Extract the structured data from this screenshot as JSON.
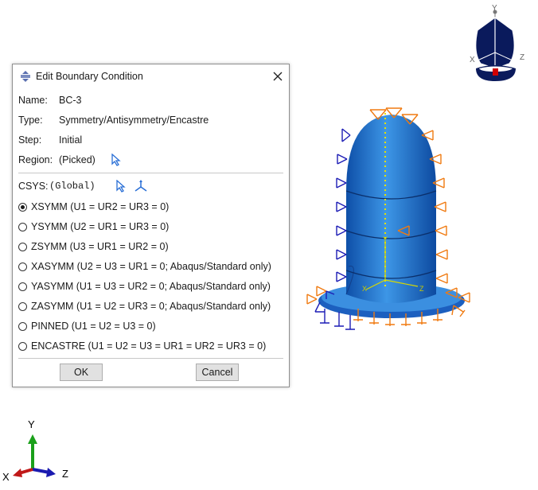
{
  "dialog": {
    "title": "Edit Boundary Condition",
    "name_label": "Name:",
    "name_value": "BC-3",
    "type_label": "Type:",
    "type_value": "Symmetry/Antisymmetry/Encastre",
    "step_label": "Step:",
    "step_value": "Initial",
    "region_label": "Region:",
    "region_value": "(Picked)",
    "csys_label": "CSYS:",
    "csys_value": "(Global)",
    "options": [
      {
        "label": "XSYMM (U1 = UR2 = UR3 = 0)",
        "selected": true
      },
      {
        "label": "YSYMM (U2 = UR1 = UR3 = 0)",
        "selected": false
      },
      {
        "label": "ZSYMM (U3 = UR1 = UR2 = 0)",
        "selected": false
      },
      {
        "label": "XASYMM (U2 = U3 = UR1 = 0; Abaqus/Standard only)",
        "selected": false
      },
      {
        "label": "YASYMM (U1 = U3 = UR2 = 0; Abaqus/Standard only)",
        "selected": false
      },
      {
        "label": "ZASYMM (U1 = U2 = UR3 = 0; Abaqus/Standard only)",
        "selected": false
      },
      {
        "label": "PINNED (U1 = U2 = U3 = 0)",
        "selected": false
      },
      {
        "label": "ENCASTRE (U1 = U2 = U3 = UR1 = UR2 = UR3 = 0)",
        "selected": false
      }
    ],
    "ok_label": "OK",
    "cancel_label": "Cancel"
  },
  "view_cube": {
    "y": "Y",
    "x": "X",
    "z": "Z"
  },
  "triad": {
    "y": "Y",
    "x": "X",
    "z": "Z"
  },
  "model": {
    "y": "Y",
    "x": "X",
    "z": "Z"
  },
  "colors": {
    "model_blue": "#2a7fd4",
    "bc_orange": "#f07a10",
    "bc_blue": "#1c1cb5",
    "view_cube_navy": "#0a1a5c",
    "triad_green": "#1aa01a",
    "triad_red": "#c01818",
    "triad_blue": "#1a1ab0"
  }
}
